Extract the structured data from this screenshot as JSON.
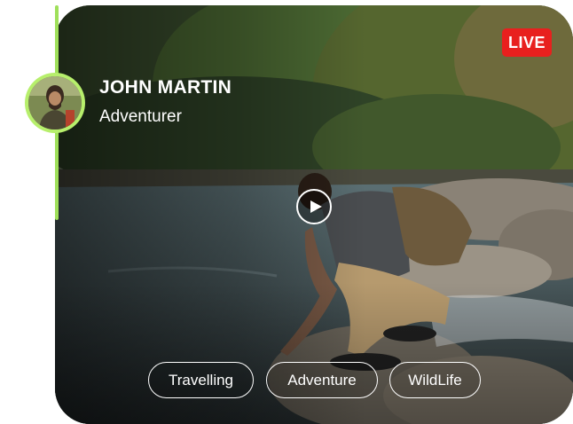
{
  "profile": {
    "name": "JOHN MARTIN",
    "role": "Adventurer"
  },
  "status": {
    "live_label": "LIVE",
    "live_color": "#e8201e"
  },
  "accent_color": "#9fe05a",
  "tags": [
    "Travelling",
    "Adventure",
    "WildLife"
  ],
  "icons": {
    "play": "play-icon"
  }
}
